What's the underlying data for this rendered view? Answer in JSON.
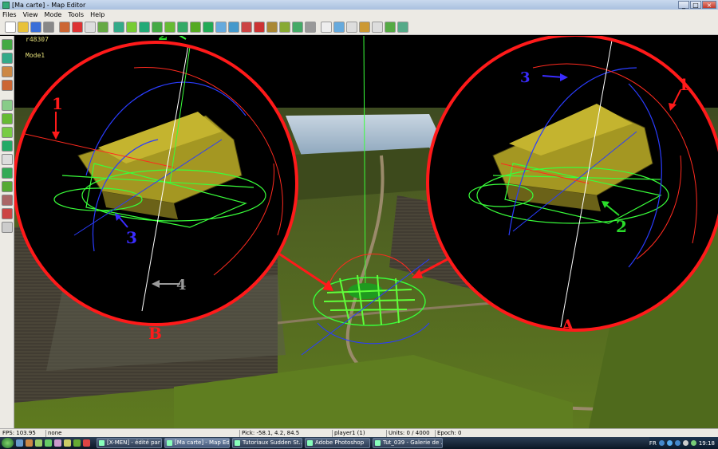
{
  "window": {
    "title": "[Ma carte] - Map Editor",
    "minimize": "_",
    "maximize": "□",
    "close": "×"
  },
  "menu": [
    "Files",
    "View",
    "Mode",
    "Tools",
    "Help"
  ],
  "viewport": {
    "object_id": "r48307",
    "mode_label": "Mode1"
  },
  "annotations": {
    "left_circle_caption": "B",
    "right_circle_caption": "A",
    "left_numbers": [
      "1",
      "2",
      "3",
      "4"
    ],
    "right_numbers": [
      "1",
      "2",
      "3"
    ]
  },
  "statusbar": {
    "fps": "FPS: 103.95",
    "selection": "none",
    "pick": "Pick: -58.1, 4.2, 84.5",
    "player": "player1 (1)",
    "units": "Units: 0 / 4000",
    "epoch": "Epoch: 0"
  },
  "taskbar": {
    "tasks": [
      "[X-MEN] - édité par ...",
      "[Ma carte] - Map Ed...",
      "Tutoriaux Sudden St...",
      "Adobe Photoshop",
      "Tut_039 - Galerie de ..."
    ],
    "language": "FR",
    "clock": "19:18"
  },
  "colors": {
    "axis_red": "#ff2a1f",
    "axis_green": "#39ff3a",
    "axis_blue": "#2a3cff",
    "axis_white": "#ffffff",
    "label_green": "#2adb2a",
    "label_blue": "#3a2cff",
    "label_red": "#ff1a1a",
    "label_gray": "#9a9a9a"
  }
}
